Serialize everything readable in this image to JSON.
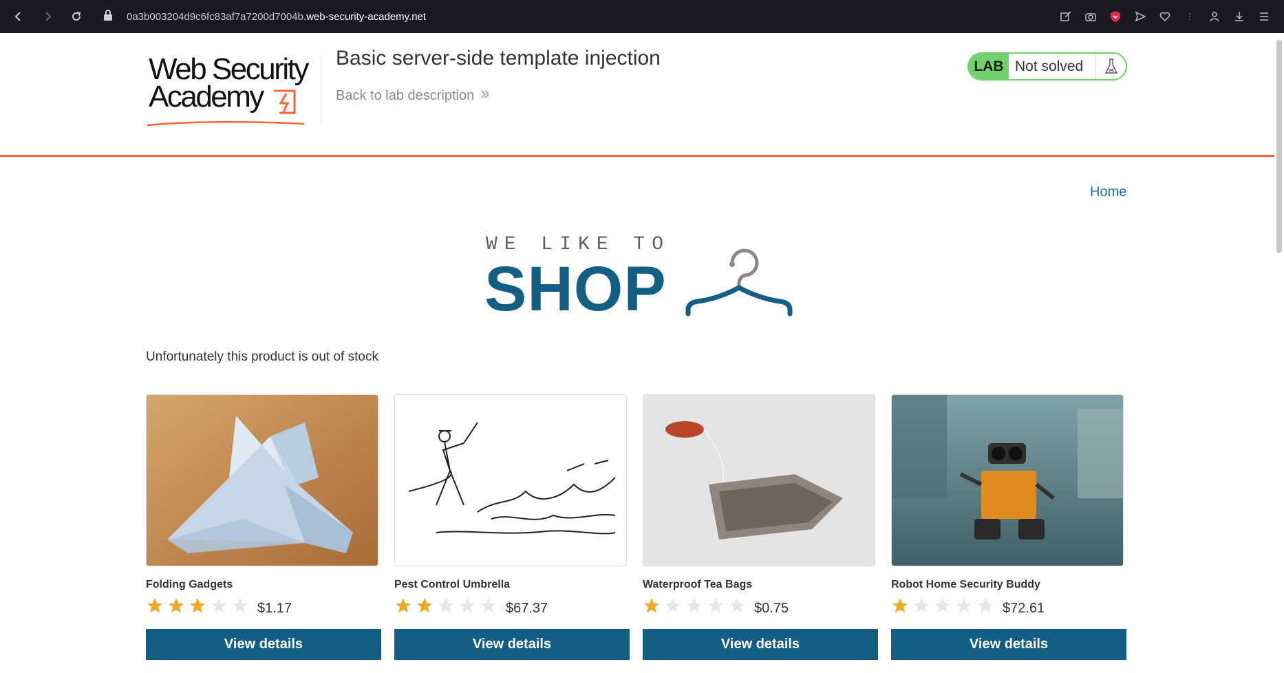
{
  "browser": {
    "url_prefix": "0a3b003204d9c6fc83af7a7200d7004b",
    "url_host": ".web-security-academy.net",
    "nav_icons": [
      "back-icon",
      "forward-icon",
      "reload-icon",
      "lock-icon"
    ],
    "tool_icons": [
      "edit-icon",
      "camera-icon",
      "shield-icon",
      "send-icon",
      "heart-icon",
      "profile-icon",
      "download-icon",
      "menu-icon"
    ]
  },
  "lab": {
    "logo_line1": "Web Security",
    "logo_line2": "Academy",
    "title": "Basic server-side template injection",
    "back_link": "Back to lab description",
    "status_badge": "LAB",
    "status_text": "Not solved"
  },
  "shop": {
    "home_link": "Home",
    "brand_top": "WE LIKE TO",
    "brand_main": "SHOP",
    "out_of_stock_message": "Unfortunately this product is out of stock",
    "colors": {
      "accent": "#135e84",
      "lab_orange": "#ff6633",
      "lab_green": "#70d16d",
      "star": "#f5a623"
    },
    "products": [
      {
        "name": "Folding Gadgets",
        "rating": 3,
        "price": "$1.17",
        "button": "View details"
      },
      {
        "name": "Pest Control Umbrella",
        "rating": 2,
        "price": "$67.37",
        "button": "View details"
      },
      {
        "name": "Waterproof Tea Bags",
        "rating": 1,
        "price": "$0.75",
        "button": "View details"
      },
      {
        "name": "Robot Home Security Buddy",
        "rating": 1,
        "price": "$72.61",
        "button": "View details"
      }
    ]
  }
}
